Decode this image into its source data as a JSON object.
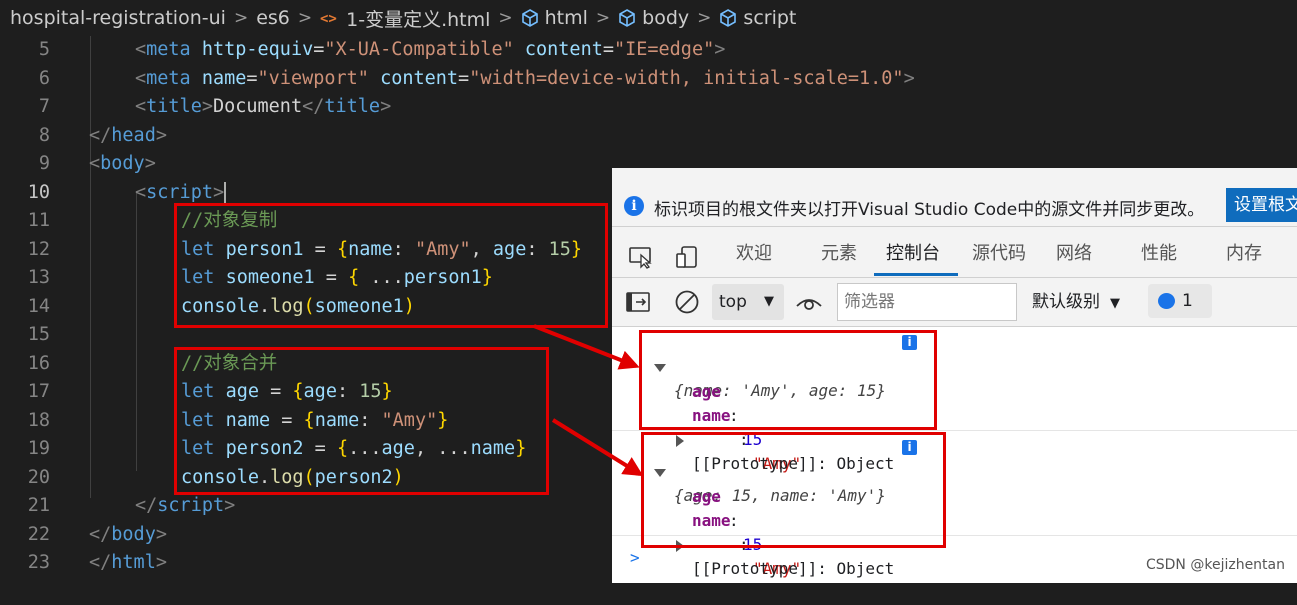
{
  "breadcrumb": {
    "items": [
      "hospital-registration-ui",
      "es6",
      "1-变量定义.html",
      "html",
      "body",
      "script"
    ],
    "separator": ">"
  },
  "editor": {
    "active_line": 10,
    "lines": [
      {
        "n": "5",
        "tokens": [
          {
            "c": "t-br",
            "t": "<"
          },
          {
            "c": "t-tag",
            "t": "meta "
          },
          {
            "c": "t-attr",
            "t": "http-equiv"
          },
          {
            "c": "t-txt",
            "t": "="
          },
          {
            "c": "t-str",
            "t": "\"X-UA-Compatible\""
          },
          {
            "c": "t-txt",
            "t": " "
          },
          {
            "c": "t-attr",
            "t": "content"
          },
          {
            "c": "t-txt",
            "t": "="
          },
          {
            "c": "t-str",
            "t": "\"IE=edge\""
          },
          {
            "c": "t-br",
            "t": ">"
          }
        ]
      },
      {
        "n": "6",
        "tokens": [
          {
            "c": "t-br",
            "t": "<"
          },
          {
            "c": "t-tag",
            "t": "meta "
          },
          {
            "c": "t-attr",
            "t": "name"
          },
          {
            "c": "t-txt",
            "t": "="
          },
          {
            "c": "t-str",
            "t": "\"viewport\""
          },
          {
            "c": "t-txt",
            "t": " "
          },
          {
            "c": "t-attr",
            "t": "content"
          },
          {
            "c": "t-txt",
            "t": "="
          },
          {
            "c": "t-str",
            "t": "\"width=device-width, initial-scale=1.0\""
          },
          {
            "c": "t-br",
            "t": ">"
          }
        ]
      },
      {
        "n": "7",
        "tokens": [
          {
            "c": "t-br",
            "t": "<"
          },
          {
            "c": "t-tag",
            "t": "title"
          },
          {
            "c": "t-br",
            "t": ">"
          },
          {
            "c": "t-txt",
            "t": "Document"
          },
          {
            "c": "t-br",
            "t": "</"
          },
          {
            "c": "t-tag",
            "t": "title"
          },
          {
            "c": "t-br",
            "t": ">"
          }
        ]
      },
      {
        "n": "8",
        "tokens": [
          {
            "c": "t-br",
            "t": "</"
          },
          {
            "c": "t-tag",
            "t": "head"
          },
          {
            "c": "t-br",
            "t": ">"
          }
        ]
      },
      {
        "n": "9",
        "tokens": [
          {
            "c": "t-br",
            "t": "<"
          },
          {
            "c": "t-tag",
            "t": "body"
          },
          {
            "c": "t-br",
            "t": ">"
          }
        ]
      },
      {
        "n": "10",
        "tokens": [
          {
            "c": "t-br",
            "t": "<"
          },
          {
            "c": "t-tag",
            "t": "script"
          },
          {
            "c": "t-br",
            "t": ">"
          }
        ]
      },
      {
        "n": "11",
        "tokens": [
          {
            "c": "t-com",
            "t": "//对象复制"
          }
        ]
      },
      {
        "n": "12",
        "tokens": [
          {
            "c": "t-kw",
            "t": "let "
          },
          {
            "c": "t-var",
            "t": "person1"
          },
          {
            "c": "t-txt",
            "t": " = "
          },
          {
            "c": "t-br1",
            "t": "{"
          },
          {
            "c": "t-var",
            "t": "name"
          },
          {
            "c": "t-txt",
            "t": ": "
          },
          {
            "c": "t-str",
            "t": "\"Amy\""
          },
          {
            "c": "t-txt",
            "t": ", "
          },
          {
            "c": "t-var",
            "t": "age"
          },
          {
            "c": "t-txt",
            "t": ": "
          },
          {
            "c": "t-num",
            "t": "15"
          },
          {
            "c": "t-br1",
            "t": "}"
          }
        ]
      },
      {
        "n": "13",
        "tokens": [
          {
            "c": "t-kw",
            "t": "let "
          },
          {
            "c": "t-var",
            "t": "someone1"
          },
          {
            "c": "t-txt",
            "t": " = "
          },
          {
            "c": "t-br1",
            "t": "{"
          },
          {
            "c": "t-txt",
            "t": " ..."
          },
          {
            "c": "t-var",
            "t": "person1"
          },
          {
            "c": "t-br1",
            "t": "}"
          }
        ]
      },
      {
        "n": "14",
        "tokens": [
          {
            "c": "t-var",
            "t": "console"
          },
          {
            "c": "t-txt",
            "t": "."
          },
          {
            "c": "t-fn",
            "t": "log"
          },
          {
            "c": "t-br1",
            "t": "("
          },
          {
            "c": "t-var",
            "t": "someone1"
          },
          {
            "c": "t-br1",
            "t": ")"
          }
        ]
      },
      {
        "n": "15",
        "tokens": []
      },
      {
        "n": "16",
        "tokens": [
          {
            "c": "t-com",
            "t": "//对象合并"
          }
        ]
      },
      {
        "n": "17",
        "tokens": [
          {
            "c": "t-kw",
            "t": "let "
          },
          {
            "c": "t-var",
            "t": "age"
          },
          {
            "c": "t-txt",
            "t": " = "
          },
          {
            "c": "t-br1",
            "t": "{"
          },
          {
            "c": "t-var",
            "t": "age"
          },
          {
            "c": "t-txt",
            "t": ": "
          },
          {
            "c": "t-num",
            "t": "15"
          },
          {
            "c": "t-br1",
            "t": "}"
          }
        ]
      },
      {
        "n": "18",
        "tokens": [
          {
            "c": "t-kw",
            "t": "let "
          },
          {
            "c": "t-var",
            "t": "name"
          },
          {
            "c": "t-txt",
            "t": " = "
          },
          {
            "c": "t-br1",
            "t": "{"
          },
          {
            "c": "t-var",
            "t": "name"
          },
          {
            "c": "t-txt",
            "t": ": "
          },
          {
            "c": "t-str",
            "t": "\"Amy\""
          },
          {
            "c": "t-br1",
            "t": "}"
          }
        ]
      },
      {
        "n": "19",
        "tokens": [
          {
            "c": "t-kw",
            "t": "let "
          },
          {
            "c": "t-var",
            "t": "person2"
          },
          {
            "c": "t-txt",
            "t": " = "
          },
          {
            "c": "t-br1",
            "t": "{"
          },
          {
            "c": "t-txt",
            "t": "..."
          },
          {
            "c": "t-var",
            "t": "age"
          },
          {
            "c": "t-txt",
            "t": ", ..."
          },
          {
            "c": "t-var",
            "t": "name"
          },
          {
            "c": "t-br1",
            "t": "}"
          }
        ]
      },
      {
        "n": "20",
        "tokens": [
          {
            "c": "t-var",
            "t": "console"
          },
          {
            "c": "t-txt",
            "t": "."
          },
          {
            "c": "t-fn",
            "t": "log"
          },
          {
            "c": "t-br1",
            "t": "("
          },
          {
            "c": "t-var",
            "t": "person2"
          },
          {
            "c": "t-br1",
            "t": ")"
          }
        ]
      },
      {
        "n": "21",
        "tokens": [
          {
            "c": "t-br",
            "t": "</"
          },
          {
            "c": "t-tag",
            "t": "script"
          },
          {
            "c": "t-br",
            "t": ">"
          }
        ]
      },
      {
        "n": "22",
        "tokens": [
          {
            "c": "t-br",
            "t": "</"
          },
          {
            "c": "t-tag",
            "t": "body"
          },
          {
            "c": "t-br",
            "t": ">"
          }
        ]
      },
      {
        "n": "23",
        "tokens": [
          {
            "c": "t-br",
            "t": "</"
          },
          {
            "c": "t-tag",
            "t": "html"
          },
          {
            "c": "t-br",
            "t": ">"
          }
        ]
      }
    ]
  },
  "devtools": {
    "info_message": "标识项目的根文件夹以打开Visual Studio Code中的源文件并同步更改。",
    "info_button": "设置根文件夹",
    "tabs": [
      "欢迎",
      "元素",
      "控制台",
      "源代码",
      "网络",
      "性能",
      "内存"
    ],
    "active_tab": "控制台",
    "context": "top",
    "filter_placeholder": "筛选器",
    "level": "默认级别",
    "issues_count": "1",
    "logs": [
      {
        "summary": "{name: 'Amy', age: 15}",
        "props": [
          {
            "key": "age",
            "value": "15",
            "kind": "num"
          },
          {
            "key": "name",
            "value": "\"Amy\"",
            "kind": "str"
          }
        ],
        "prototype": "[[Prototype]]: Object"
      },
      {
        "summary": "{age: 15, name: 'Amy'}",
        "props": [
          {
            "key": "age",
            "value": "15",
            "kind": "num"
          },
          {
            "key": "name",
            "value": "\"Amy\"",
            "kind": "str"
          }
        ],
        "prototype": "[[Prototype]]: Object"
      }
    ],
    "prompt": ">"
  },
  "watermark": "CSDN @kejizhentan",
  "colors": {
    "annotation": "#e00000",
    "accent": "#0f6cbd"
  }
}
